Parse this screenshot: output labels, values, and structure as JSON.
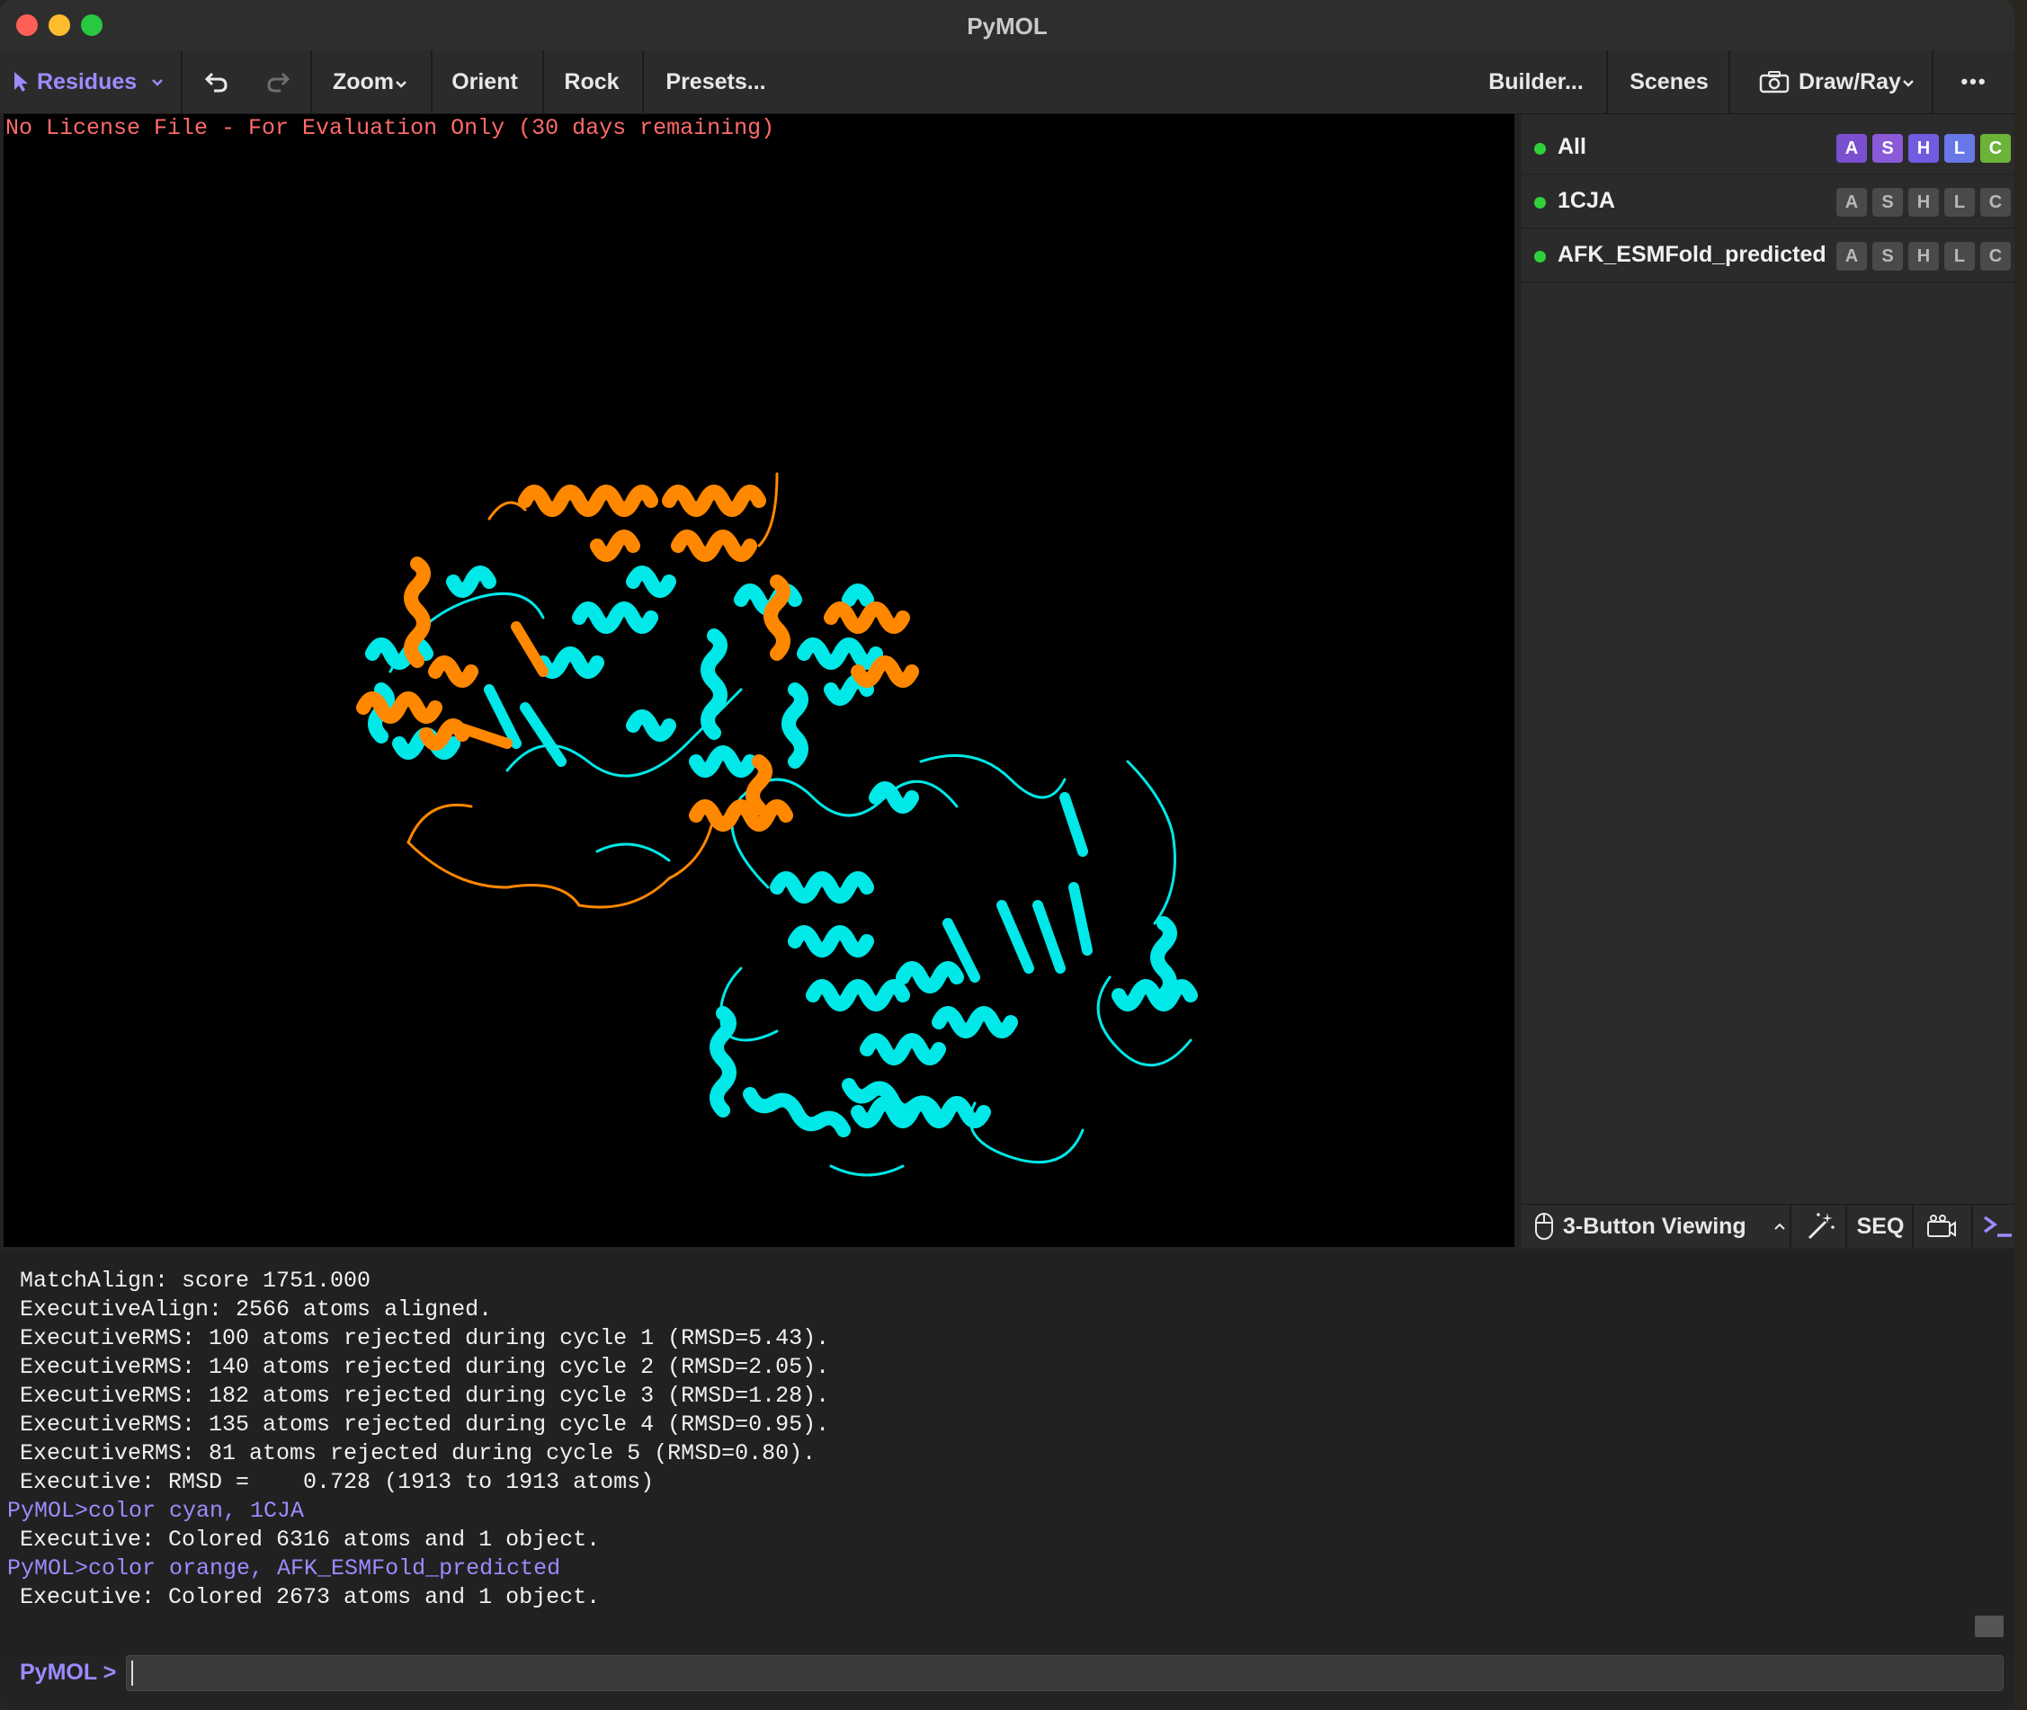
{
  "window": {
    "title": "PyMOL"
  },
  "toolbar": {
    "selection_mode": "Residues",
    "undo_icon": "undo-icon",
    "redo_icon": "redo-icon",
    "zoom": "Zoom",
    "orient": "Orient",
    "rock": "Rock",
    "presets": "Presets...",
    "builder": "Builder...",
    "scenes": "Scenes",
    "drawray": "Draw/Ray",
    "more": "•••"
  },
  "viewer": {
    "license_notice": "No License File - For Evaluation Only (30 days remaining)",
    "colors": {
      "structure_1": "#00e8e8",
      "structure_2": "#ff8800"
    }
  },
  "objects": [
    {
      "name": "All",
      "buttons": [
        "A",
        "S",
        "H",
        "L",
        "C"
      ],
      "button_colors": [
        "#7a4fd0",
        "#8a5ad8",
        "#6f5ce0",
        "#6878e8",
        "#6cb33a"
      ]
    },
    {
      "name": "1CJA",
      "buttons": [
        "A",
        "S",
        "H",
        "L",
        "C"
      ]
    },
    {
      "name": "AFK_ESMFold_predicted",
      "buttons": [
        "A",
        "S",
        "H",
        "L",
        "C"
      ]
    }
  ],
  "bottom_bar": {
    "mouse_mode": "3-Button Viewing",
    "seq": "SEQ",
    "icons": [
      "mouse-icon",
      "chevron-up-icon",
      "wand-icon",
      "camera-icon",
      "terminal-icon"
    ]
  },
  "console": {
    "lines": [
      {
        "text": "MatchAlign: score 1751.000",
        "type": "output"
      },
      {
        "text": "ExecutiveAlign: 2566 atoms aligned.",
        "type": "output"
      },
      {
        "text": "ExecutiveRMS: 100 atoms rejected during cycle 1 (RMSD=5.43).",
        "type": "output"
      },
      {
        "text": "ExecutiveRMS: 140 atoms rejected during cycle 2 (RMSD=2.05).",
        "type": "output"
      },
      {
        "text": "ExecutiveRMS: 182 atoms rejected during cycle 3 (RMSD=1.28).",
        "type": "output"
      },
      {
        "text": "ExecutiveRMS: 135 atoms rejected during cycle 4 (RMSD=0.95).",
        "type": "output"
      },
      {
        "text": "ExecutiveRMS: 81 atoms rejected during cycle 5 (RMSD=0.80).",
        "type": "output"
      },
      {
        "text": "Executive: RMSD =    0.728 (1913 to 1913 atoms)",
        "type": "output"
      },
      {
        "text": "PyMOL>color cyan, 1CJA",
        "type": "command"
      },
      {
        "text": "Executive: Colored 6316 atoms and 1 object.",
        "type": "output"
      },
      {
        "text": "PyMOL>color orange, AFK_ESMFold_predicted",
        "type": "command"
      },
      {
        "text": "Executive: Colored 2673 atoms and 1 object.",
        "type": "output"
      }
    ],
    "prompt": "PyMOL >",
    "input_value": ""
  }
}
